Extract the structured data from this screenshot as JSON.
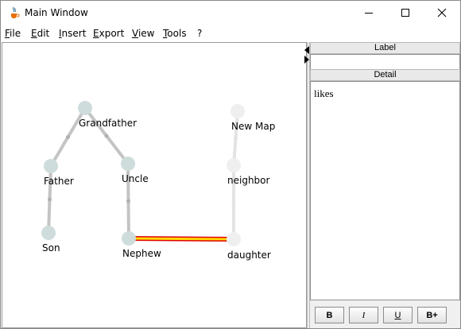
{
  "window": {
    "title": "Main Window",
    "icon": "java-cup-icon",
    "controls": [
      "minimize-icon",
      "maximize-icon",
      "close-icon"
    ]
  },
  "menu": [
    {
      "label": "File",
      "mnemonic": "F",
      "rest": "ile"
    },
    {
      "label": "Edit",
      "mnemonic": "E",
      "rest": "dit"
    },
    {
      "label": "Insert",
      "mnemonic": "I",
      "rest": "nsert"
    },
    {
      "label": "Export",
      "mnemonic": "E",
      "rest": "xport"
    },
    {
      "label": "View",
      "mnemonic": "V",
      "rest": "iew"
    },
    {
      "label": "Tools",
      "mnemonic": "T",
      "rest": "ools"
    },
    {
      "label": "?",
      "mnemonic": "",
      "rest": "?"
    }
  ],
  "graph": {
    "nodes": [
      {
        "id": "grandfather",
        "label": "Grandfather",
        "style": "active"
      },
      {
        "id": "father",
        "label": "Father",
        "style": "active"
      },
      {
        "id": "uncle",
        "label": "Uncle",
        "style": "active"
      },
      {
        "id": "son",
        "label": "Son",
        "style": "active"
      },
      {
        "id": "nephew",
        "label": "Nephew",
        "style": "active"
      },
      {
        "id": "newmap",
        "label": "New Map",
        "style": "faded"
      },
      {
        "id": "neighbor",
        "label": "neighbor",
        "style": "faded"
      },
      {
        "id": "daughter",
        "label": "daughter",
        "style": "faded"
      }
    ],
    "edges": [
      {
        "from": "grandfather",
        "to": "father",
        "selected": false
      },
      {
        "from": "grandfather",
        "to": "uncle",
        "selected": false
      },
      {
        "from": "father",
        "to": "son",
        "selected": false
      },
      {
        "from": "uncle",
        "to": "nephew",
        "selected": false
      },
      {
        "from": "newmap",
        "to": "neighbor",
        "selected": false
      },
      {
        "from": "neighbor",
        "to": "daughter",
        "selected": false
      },
      {
        "from": "nephew",
        "to": "daughter",
        "selected": true
      }
    ],
    "colors": {
      "active_node": "#cfdcdc",
      "faded_node": "#efefef",
      "edge": "#c4c4c4",
      "faded_edge": "#e3e3e3",
      "selected_edge_outer": "#e00000",
      "selected_edge_inner": "#ffd800"
    }
  },
  "side": {
    "label_header": "Label",
    "label_value": "",
    "detail_header": "Detail",
    "detail_text": "likes",
    "buttons": {
      "bold": "B",
      "italic": "I",
      "underline": "U",
      "bigger": "B+"
    }
  }
}
